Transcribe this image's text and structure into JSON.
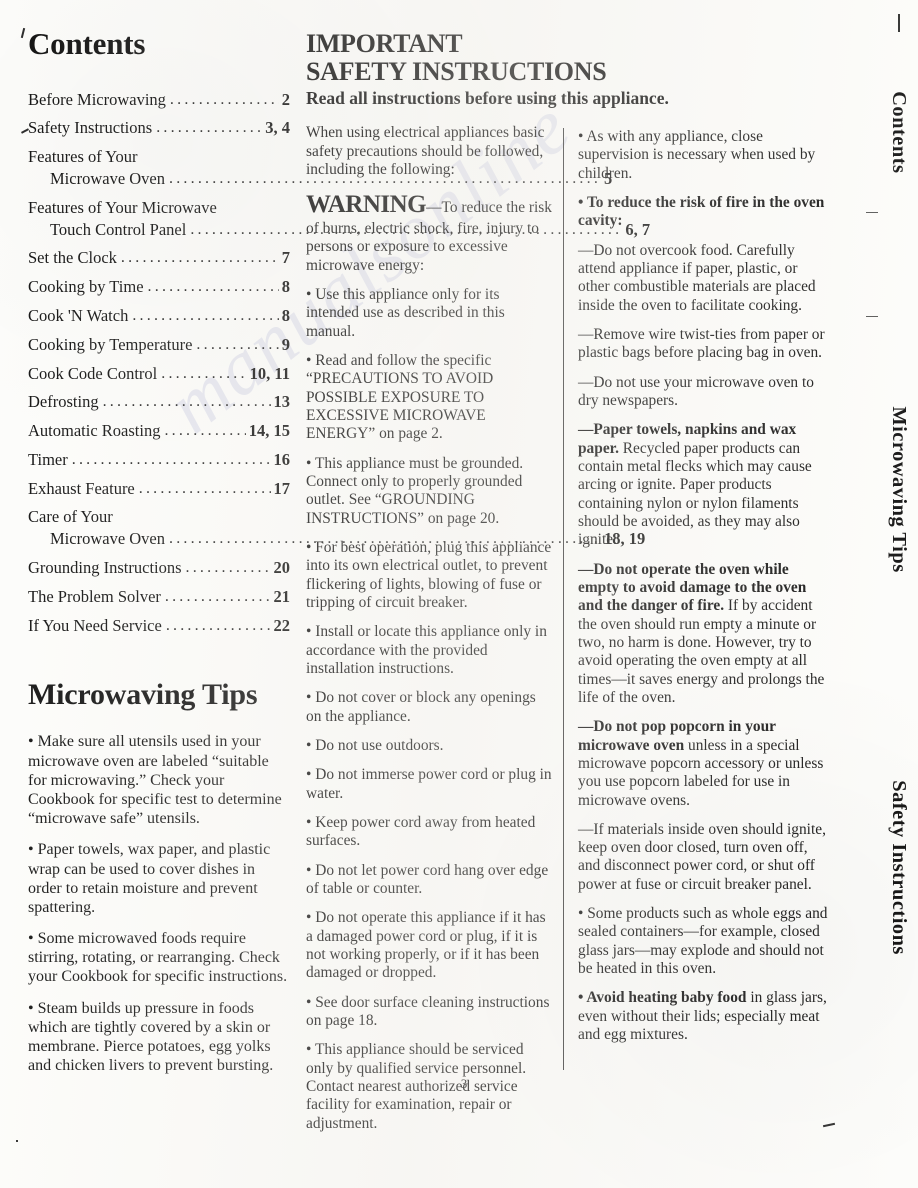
{
  "page": {
    "number": "3",
    "watermark_text": "manualsonline"
  },
  "side_tabs": [
    {
      "label": "Contents"
    },
    {
      "label": "Microwaving Tips"
    },
    {
      "label": "Safety Instructions"
    }
  ],
  "contents": {
    "heading": "Contents",
    "entries": [
      {
        "label": "Before Microwaving",
        "label2": "",
        "page": "2"
      },
      {
        "label": "Safety Instructions",
        "label2": "",
        "page": "3, 4"
      },
      {
        "label": "Features of Your",
        "label2": "Microwave Oven",
        "page": "5"
      },
      {
        "label": "Features of Your Microwave",
        "label2": "Touch Control Panel",
        "page": "6, 7"
      },
      {
        "label": "Set the Clock",
        "label2": "",
        "page": "7"
      },
      {
        "label": "Cooking by Time",
        "label2": "",
        "page": "8"
      },
      {
        "label": "Cook 'N Watch",
        "label2": "",
        "page": "8"
      },
      {
        "label": "Cooking by Temperature",
        "label2": "",
        "page": "9"
      },
      {
        "label": "Cook Code Control",
        "label2": "",
        "page": "10, 11"
      },
      {
        "label": "Defrosting",
        "label2": "",
        "page": "13"
      },
      {
        "label": "Automatic Roasting",
        "label2": "",
        "page": "14, 15"
      },
      {
        "label": "Timer",
        "label2": "",
        "page": "16"
      },
      {
        "label": "Exhaust Feature",
        "label2": "",
        "page": "17"
      },
      {
        "label": "Care of Your",
        "label2": "Microwave Oven",
        "page": "18, 19"
      },
      {
        "label": "Grounding Instructions",
        "label2": "",
        "page": "20"
      },
      {
        "label": "The Problem Solver",
        "label2": "",
        "page": "21"
      },
      {
        "label": "If You Need Service",
        "label2": "",
        "page": "22"
      }
    ]
  },
  "tips": {
    "heading": "Microwaving Tips",
    "items": [
      "• Make sure all utensils used in your microwave oven are labeled “suitable for microwaving.” Check your Cookbook for specific test to determine “microwave safe” utensils.",
      "• Paper towels, wax paper, and plastic wrap can be used to cover dishes in order to retain moisture and prevent spattering.",
      "• Some microwaved foods require stirring, rotating, or rearranging. Check your Cookbook for specific instructions.",
      "• Steam builds up pressure in foods which are tightly covered by a skin or membrane. Pierce potatoes, egg yolks and chicken livers to prevent bursting."
    ]
  },
  "safety": {
    "title_line1": "IMPORTANT",
    "title_line2": "SAFETY INSTRUCTIONS",
    "subtitle": "Read all instructions before using this appliance.",
    "intro": "When using electrical appliances basic safety precautions should be followed, including the following:",
    "warning_word": "WARNING",
    "warning_text": "—To reduce the risk of burns, electric shock, fire, injury to persons or exposure to excessive microwave energy:",
    "middle_items": [
      "• Use this appliance only for its intended use as described in this manual.",
      "• Read and follow the specific “PRECAUTIONS TO AVOID POSSIBLE EXPOSURE TO EXCESSIVE MICROWAVE ENERGY” on page 2.",
      "• This appliance must be grounded. Connect only to properly grounded outlet. See “GROUNDING INSTRUCTIONS” on page 20.",
      "• For best operation, plug this appliance into its own electrical outlet, to prevent flickering of lights, blowing of fuse or tripping of circuit breaker.",
      "• Install or locate this appliance only in accordance with the provided installation instructions.",
      "• Do not cover or block any openings on the appliance.",
      "• Do not use outdoors.",
      "• Do not immerse power cord or plug in water.",
      "• Keep power cord away from heated surfaces.",
      "• Do not let power cord hang over edge of table or counter.",
      "• Do not operate this appliance if it has a damaged power cord or plug, if it is not working properly, or if it has been damaged or dropped.",
      "• See door surface cleaning instructions on page 18.",
      "• This appliance should be serviced only by qualified service personnel. Contact nearest authorized service facility for examination, repair or adjustment."
    ],
    "right_items": [
      {
        "bold": "",
        "text": "• As with any appliance, close supervision is necessary when used by children."
      },
      {
        "bold": "• To reduce the risk of fire in the oven cavity:",
        "text": ""
      },
      {
        "bold": "",
        "text": "—Do not overcook food. Carefully attend appliance if paper, plastic, or other combustible materials are placed inside the oven to facilitate cooking."
      },
      {
        "bold": "",
        "text": "—Remove wire twist-ties from paper or plastic bags before placing bag in oven."
      },
      {
        "bold": "",
        "text": "—Do not use your microwave oven to dry newspapers."
      },
      {
        "bold": "—Paper towels, napkins and wax paper.",
        "text": " Recycled paper products can contain metal flecks which may cause arcing or ignite. Paper products containing nylon or nylon filaments should be avoided, as they may also ignite."
      },
      {
        "bold": "—Do not operate the oven while empty to avoid damage to the oven and the danger of fire.",
        "text": " If by accident the oven should run empty a minute or two, no harm is done. However, try to avoid operating the oven empty at all times—it saves energy and prolongs the life of the oven."
      },
      {
        "bold": "—Do not pop popcorn in your microwave oven",
        "text": " unless in a special microwave popcorn accessory or unless you use popcorn labeled for use in microwave ovens."
      },
      {
        "bold": "",
        "text": "—If materials inside oven should ignite, keep oven door closed, turn oven off, and disconnect power cord, or shut off power at fuse or circuit breaker panel."
      },
      {
        "bold": "",
        "text": "• Some products such as whole eggs and sealed containers—for example, closed glass jars—may explode and should not be heated in this oven."
      },
      {
        "bold": "• Avoid heating baby food",
        "text": " in glass jars, even without their lids; especially meat and egg mixtures."
      }
    ]
  }
}
